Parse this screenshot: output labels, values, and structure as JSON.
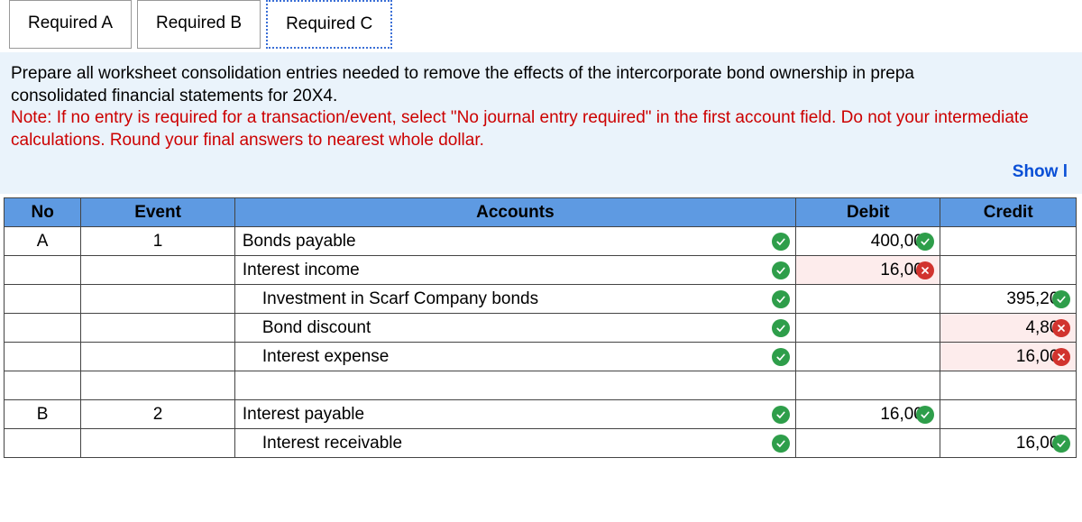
{
  "tabs": {
    "a": "Required A",
    "b": "Required B",
    "c": "Required C"
  },
  "instruction": {
    "line1": "Prepare all worksheet consolidation entries needed to remove the effects of the intercorporate bond ownership in prepa",
    "line2": "consolidated financial statements for 20X4.",
    "note": "Note: If no entry is required for a transaction/event, select \"No journal entry required\" in the first account field. Do not your intermediate calculations. Round your final answers to nearest whole dollar."
  },
  "show_less": "Show l",
  "headers": {
    "no": "No",
    "event": "Event",
    "accounts": "Accounts",
    "debit": "Debit",
    "credit": "Credit"
  },
  "rows": {
    "r1": {
      "no": "A",
      "event": "1",
      "acct": "Bonds payable",
      "debit": "400,000",
      "d_ok": true
    },
    "r2": {
      "acct": "Interest income",
      "debit": "16,000",
      "d_ok": false
    },
    "r3": {
      "acct": "Investment in Scarf Company bonds",
      "credit": "395,200",
      "c_ok": true
    },
    "r4": {
      "acct": "Bond discount",
      "credit": "4,800",
      "c_ok": false
    },
    "r5": {
      "acct": "Interest expense",
      "credit": "16,000",
      "c_ok": false
    },
    "r7": {
      "no": "B",
      "event": "2",
      "acct": "Interest payable",
      "debit": "16,000",
      "d_ok": true
    },
    "r8": {
      "acct": "Interest receivable",
      "credit": "16,000",
      "c_ok": true
    }
  }
}
